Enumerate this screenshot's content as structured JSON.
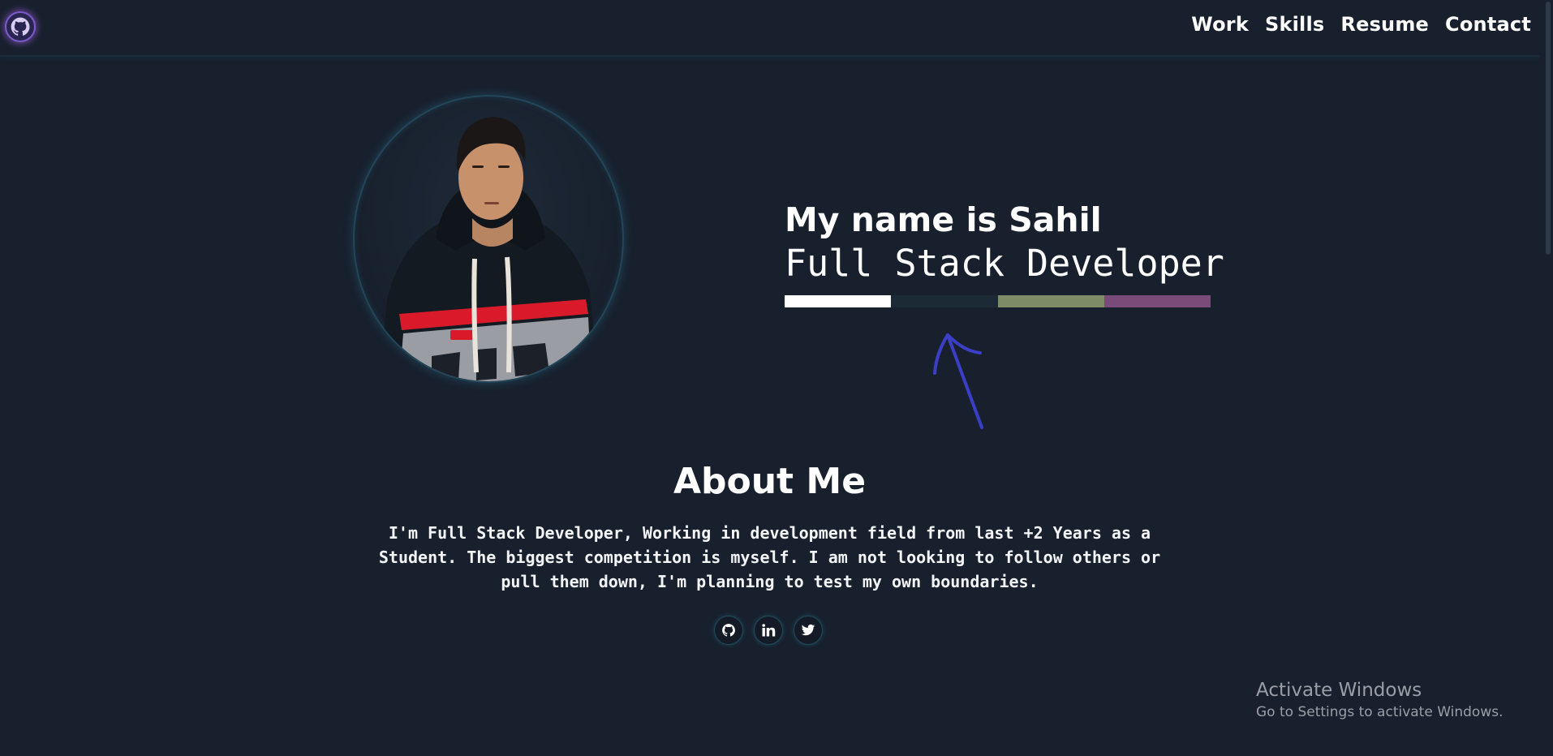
{
  "nav": {
    "logo_icon": "github-icon",
    "links": [
      "Work",
      "Skills",
      "Resume",
      "Contact"
    ]
  },
  "hero": {
    "name": "My name is Sahil",
    "role": "Full Stack Developer",
    "bar_colors": [
      "#ffffff",
      "#1c2a36",
      "#7d8c66",
      "#7a4a78"
    ]
  },
  "about": {
    "title": "About Me",
    "text": "I'm Full Stack Developer, Working in development field from last +2 Years as a Student. The biggest competition is myself. I am not looking to follow others or pull them down, I'm planning to test my own boundaries."
  },
  "socials": [
    {
      "icon": "github-icon"
    },
    {
      "icon": "linkedin-icon"
    },
    {
      "icon": "twitter-icon"
    }
  ],
  "watermark": {
    "title": "Activate Windows",
    "subtitle": "Go to Settings to activate Windows."
  },
  "colors": {
    "background": "#18202d",
    "text": "#ffffff",
    "annotation": "#3b3fc8"
  }
}
